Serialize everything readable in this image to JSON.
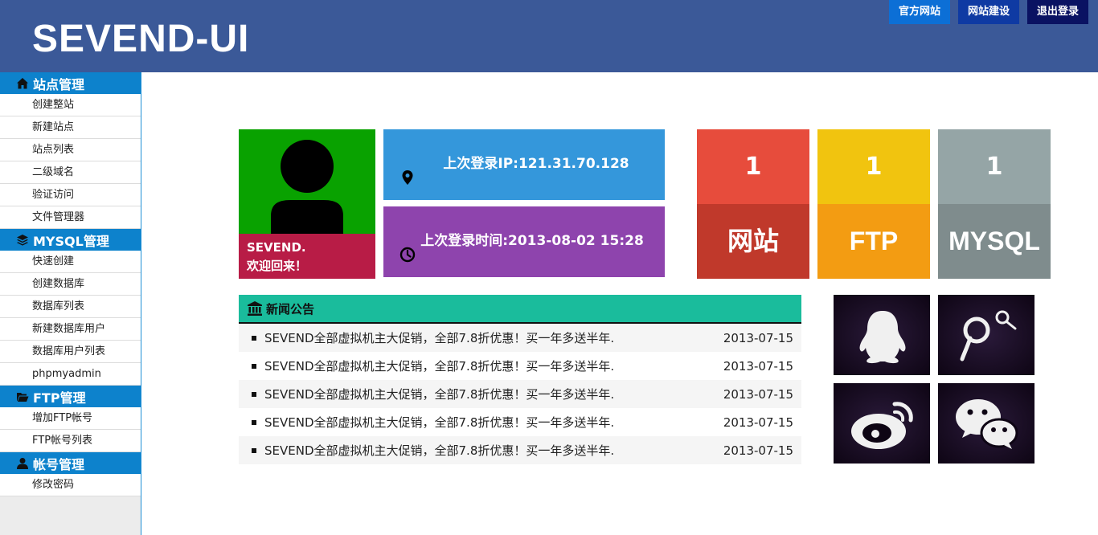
{
  "header": {
    "logo": "SEVEND-UI",
    "buttons": [
      {
        "label": "官方网站",
        "color": "#0c6fd6"
      },
      {
        "label": "网站建设",
        "color": "#0f3aa3"
      },
      {
        "label": "退出登录",
        "color": "#0a1262"
      }
    ]
  },
  "sidebar": {
    "groups": [
      {
        "title": "站点管理",
        "icon": "home-icon",
        "items": [
          "创建整站",
          "新建站点",
          "站点列表",
          "二级域名",
          "验证访问",
          "文件管理器"
        ]
      },
      {
        "title": "MYSQL管理",
        "icon": "layers-icon",
        "items": [
          "快速创建",
          "创建数据库",
          "数据库列表",
          "新建数据库用户",
          "数据库用户列表",
          "phpmyadmin"
        ]
      },
      {
        "title": "FTP管理",
        "icon": "folder-open-icon",
        "items": [
          "增加FTP帐号",
          "FTP帐号列表"
        ]
      },
      {
        "title": "帐号管理",
        "icon": "user-icon",
        "items": [
          "修改密码"
        ]
      }
    ]
  },
  "user": {
    "name": "SEVEND.",
    "welcome": "欢迎回来！"
  },
  "info": {
    "last_ip": "上次登录IP:121.31.70.128",
    "last_time": "上次登录时间:2013-08-02 15:28"
  },
  "stats": [
    {
      "value": "1",
      "label": "网站",
      "top_color": "#e74c3c",
      "bottom_color": "#c0392b"
    },
    {
      "value": "1",
      "label": "FTP",
      "top_color": "#f1c40f",
      "bottom_color": "#f39c12"
    },
    {
      "value": "1",
      "label": "MYSQL",
      "top_color": "#95a5a6",
      "bottom_color": "#7f8c8d"
    }
  ],
  "news": {
    "title": "新闻公告",
    "items": [
      {
        "title": "SEVEND全部虚拟机主大促销，全部7.8折优惠！买一年多送半年.",
        "date": "2013-07-15"
      },
      {
        "title": "SEVEND全部虚拟机主大促销，全部7.8折优惠！买一年多送半年.",
        "date": "2013-07-15"
      },
      {
        "title": "SEVEND全部虚拟机主大促销，全部7.8折优惠！买一年多送半年.",
        "date": "2013-07-15"
      },
      {
        "title": "SEVEND全部虚拟机主大促销，全部7.8折优惠！买一年多送半年.",
        "date": "2013-07-15"
      },
      {
        "title": "SEVEND全部虚拟机主大促销，全部7.8折优惠！买一年多送半年.",
        "date": "2013-07-15"
      }
    ]
  },
  "social": [
    {
      "icon": "qq-icon"
    },
    {
      "icon": "tencent-weibo-icon"
    },
    {
      "icon": "weibo-icon"
    },
    {
      "icon": "wechat-icon"
    }
  ]
}
